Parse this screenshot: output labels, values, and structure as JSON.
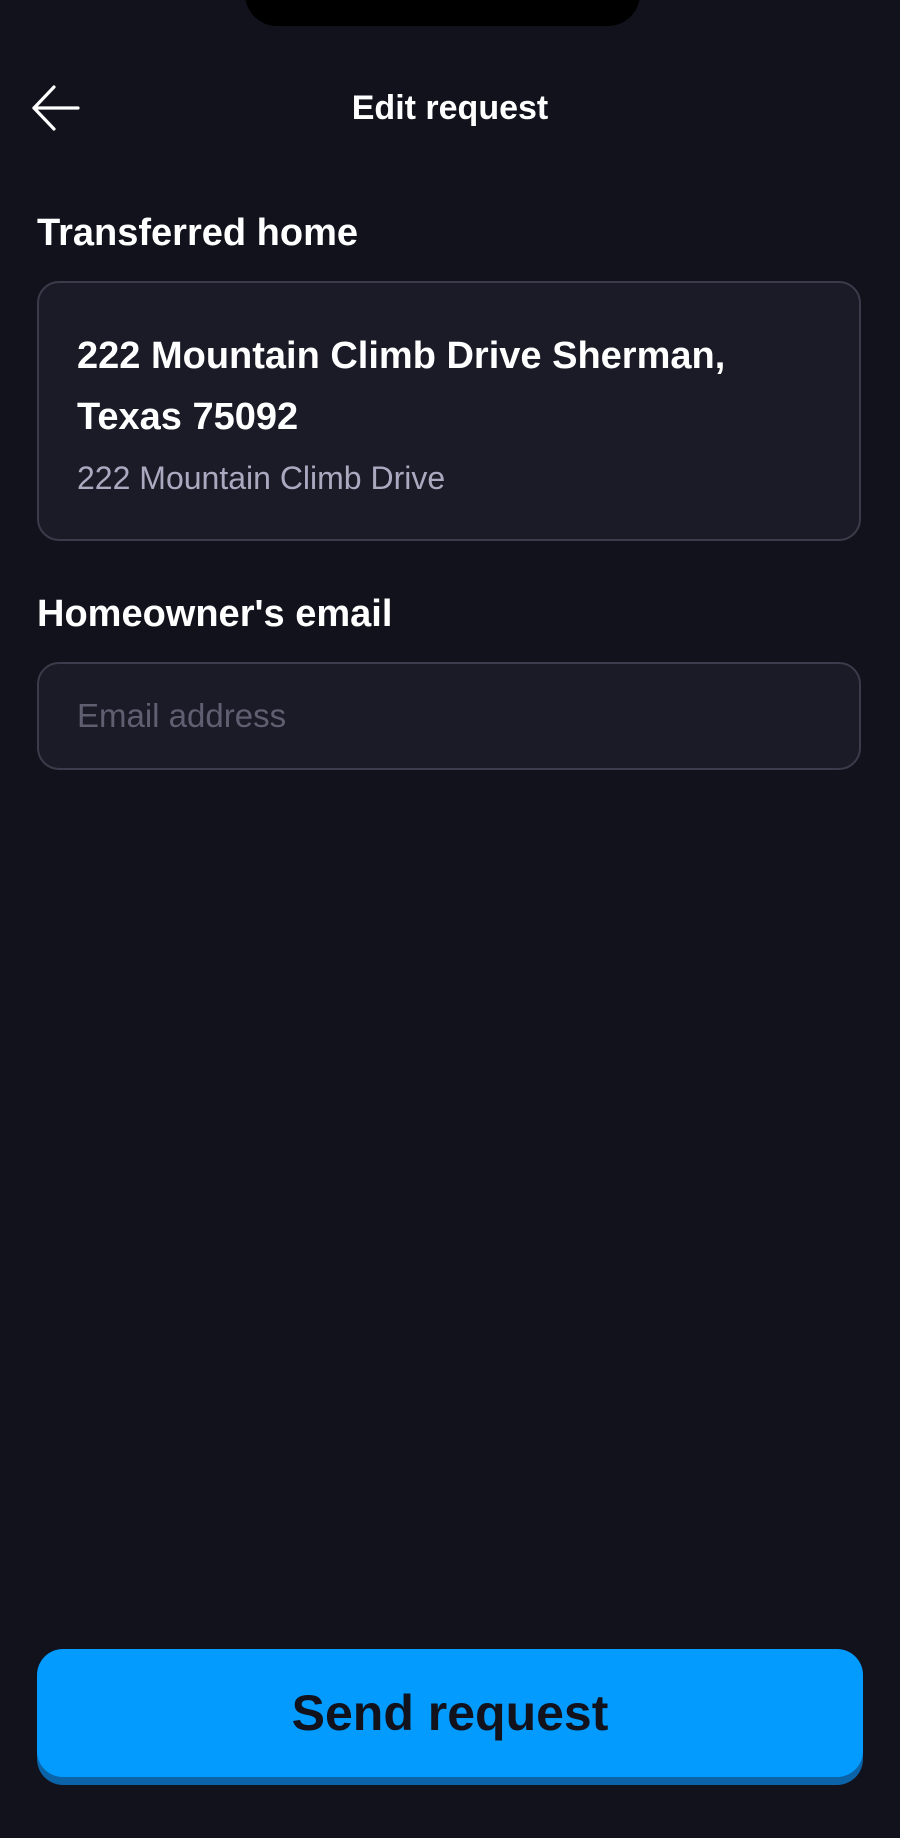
{
  "header": {
    "title": "Edit request",
    "back_icon": "arrow-left-icon"
  },
  "transferred_home": {
    "label": "Transferred home",
    "address_title": "222 Mountain Climb Drive Sherman, Texas 75092",
    "address_subtitle": "222 Mountain Climb Drive"
  },
  "homeowner_email": {
    "label": "Homeowner's email",
    "value": "",
    "placeholder": "Email address"
  },
  "footer": {
    "send_label": "Send request"
  },
  "colors": {
    "background": "#12121d",
    "card": "#1b1b27",
    "card_border": "#3b3b4b",
    "accent": "#039bfe",
    "accent_shadow": "#0b63a8",
    "muted_text": "#a9a9c0",
    "placeholder_text": "#5f5f72"
  }
}
